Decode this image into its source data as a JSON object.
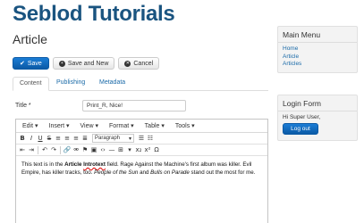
{
  "site": {
    "title": "Seblod Tutorials"
  },
  "page": {
    "heading": "Article"
  },
  "toolbar": {
    "save_label": "Save",
    "save_new_label": "Save and New",
    "cancel_label": "Cancel"
  },
  "tabs": [
    {
      "label": "Content"
    },
    {
      "label": "Publishing"
    },
    {
      "label": "Metadata"
    }
  ],
  "form": {
    "title_label": "Title *",
    "title_value": "Print_R, Nice!"
  },
  "editor": {
    "menus": [
      "Edit",
      "Insert",
      "View",
      "Format",
      "Table",
      "Tools"
    ],
    "format_select": "Paragraph",
    "content": {
      "p1": "This text is in the ",
      "b1": "Article ",
      "b2": "Introtext",
      "p2": " field. Rage Against the Machine's first album was killer. Evil Empire, has killer tracks, too. ",
      "i1": "People of the Sun",
      "p3": " and ",
      "i2": "Bulls on Parade",
      "p4": " stand out the most for me."
    }
  },
  "sidebar": {
    "main_menu": {
      "title": "Main Menu",
      "items": [
        {
          "label": "Home"
        },
        {
          "label": "Article"
        },
        {
          "label": "Articles"
        }
      ]
    },
    "login": {
      "title": "Login Form",
      "greeting": "Hi Super User,",
      "logout_label": "Log out"
    }
  }
}
